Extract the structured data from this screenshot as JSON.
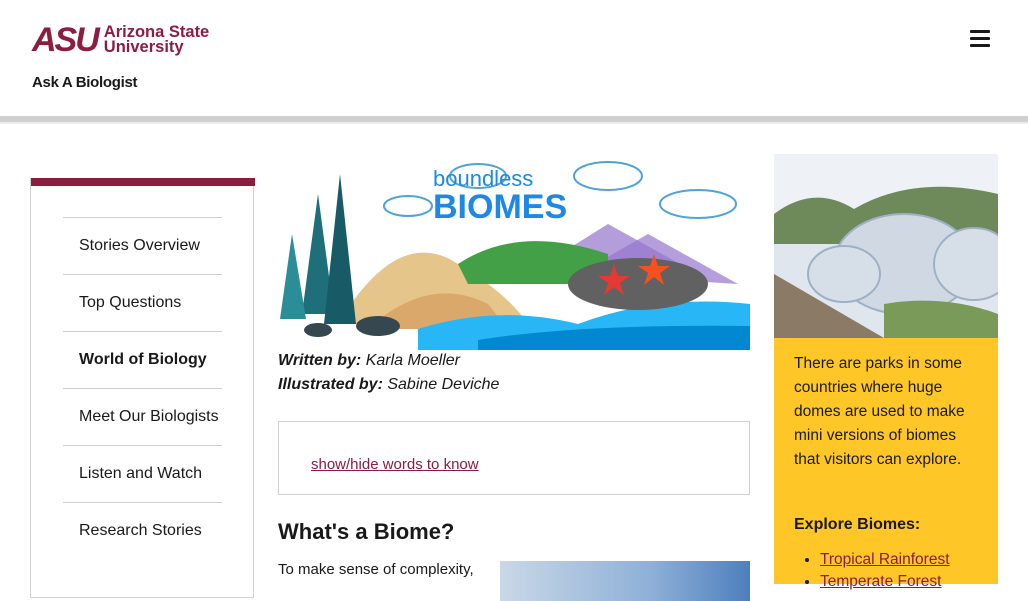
{
  "header": {
    "logo_mark": "ASU",
    "logo_line1": "Arizona State",
    "logo_line2": "University",
    "site_title": "Ask A Biologist",
    "menu_icon": "hamburger-menu-icon"
  },
  "sidebar": {
    "items": [
      {
        "label": "Stories Overview"
      },
      {
        "label": "Top Questions"
      },
      {
        "label": "World of Biology",
        "active": true
      },
      {
        "label": "Meet Our Biologists"
      },
      {
        "label": "Listen and Watch"
      },
      {
        "label": "Research Stories"
      }
    ]
  },
  "main": {
    "banner_line1": "boundless",
    "banner_line2": "BIOMES",
    "written_by_label": "Written by:",
    "written_by": "Karla Moeller",
    "illustrated_by_label": "Illustrated by:",
    "illustrated_by": "Sabine Deviche",
    "words_link": "show/hide words to know",
    "heading": "What's a Biome?",
    "intro": "To make sense of complexity,"
  },
  "aside": {
    "text": "There are parks in some countries where huge domes are used to make mini versions of biomes that visitors can explore.",
    "heading": "Explore Biomes:",
    "links": [
      "Tropical Rainforest",
      "Temperate Forest"
    ]
  },
  "colors": {
    "maroon": "#8C1D40",
    "gold": "#FFC627"
  }
}
